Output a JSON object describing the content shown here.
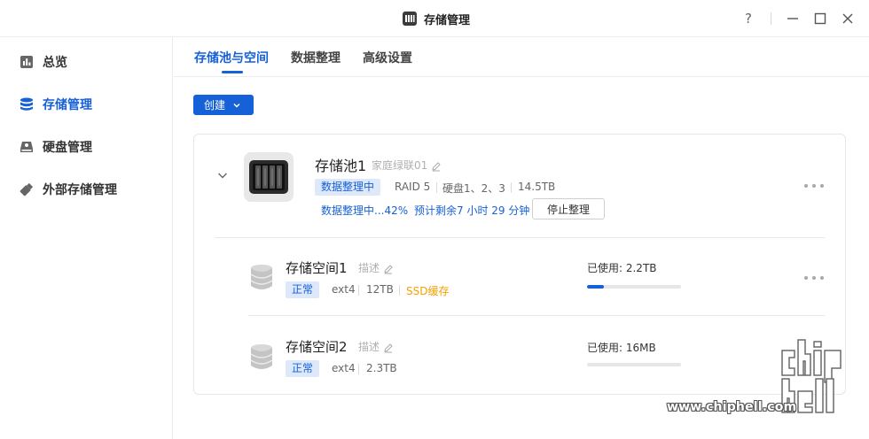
{
  "window": {
    "title": "存储管理",
    "help_symbol": "?"
  },
  "sidebar": {
    "items": [
      {
        "label": "总览",
        "icon": "chart-icon",
        "active": false
      },
      {
        "label": "存储管理",
        "icon": "database-icon",
        "active": true
      },
      {
        "label": "硬盘管理",
        "icon": "disk-icon",
        "active": false
      },
      {
        "label": "外部存储管理",
        "icon": "usb-icon",
        "active": false
      }
    ]
  },
  "tabs": [
    {
      "label": "存储池与空间",
      "active": true
    },
    {
      "label": "数据整理",
      "active": false
    },
    {
      "label": "高级设置",
      "active": false
    }
  ],
  "toolbar": {
    "create_label": "创建"
  },
  "pool": {
    "name": "存储池1",
    "description": "家庭绿联01",
    "status_badge": "数据整理中",
    "raid": "RAID 5",
    "disks": "硬盘1、2、3",
    "capacity": "14.5TB",
    "progress_text": "数据整理中...42%",
    "eta_text": "预计剩余7 小时 29 分钟",
    "stop_label": "停止整理"
  },
  "volumes": [
    {
      "name": "存储空间1",
      "description": "描述",
      "status": "正常",
      "fs": "ext4",
      "size": "12TB",
      "cache": "SSD缓存",
      "used_label": "已使用: 2.2TB",
      "used_fraction": 0.18
    },
    {
      "name": "存储空间2",
      "description": "描述",
      "status": "正常",
      "fs": "ext4",
      "size": "2.3TB",
      "used_label": "已使用: 16MB",
      "used_fraction": 0.0
    }
  ],
  "watermark": {
    "text": "www.chiphell.com",
    "logo_text": "chip hell"
  },
  "colors": {
    "accent": "#1660d8",
    "badge_bg": "#dde8fb",
    "cache": "#f5a000"
  }
}
